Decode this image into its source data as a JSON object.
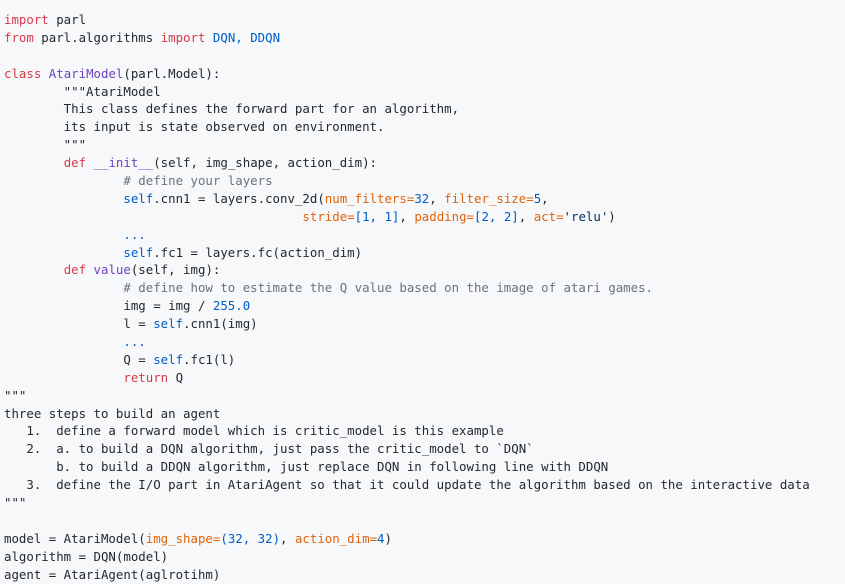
{
  "code": {
    "lines": [
      [
        {
          "t": "import",
          "c": "kw"
        },
        {
          "t": " parl",
          "c": "txt"
        }
      ],
      [
        {
          "t": "from",
          "c": "kw"
        },
        {
          "t": " parl.algorithms ",
          "c": "txt"
        },
        {
          "t": "import",
          "c": "kw"
        },
        {
          "t": " DQN, DDQN",
          "c": "num"
        }
      ],
      [],
      [
        {
          "t": "class",
          "c": "kw"
        },
        {
          "t": " AtariModel",
          "c": "cls"
        },
        {
          "t": "(parl.Model):",
          "c": "txt"
        }
      ],
      [
        {
          "t": "        \"\"\"AtariModel",
          "c": "txt"
        }
      ],
      [
        {
          "t": "        This class defines the forward part for an algorithm,",
          "c": "txt"
        }
      ],
      [
        {
          "t": "        its input is state observed on environment.",
          "c": "txt"
        }
      ],
      [
        {
          "t": "        \"\"\"",
          "c": "txt"
        }
      ],
      [
        {
          "t": "        ",
          "c": "txt"
        },
        {
          "t": "def",
          "c": "kw"
        },
        {
          "t": " __init__",
          "c": "fn"
        },
        {
          "t": "(self, img_shape, action_dim):",
          "c": "txt"
        }
      ],
      [
        {
          "t": "                # define your layers",
          "c": "cm"
        }
      ],
      [
        {
          "t": "                self",
          "c": "num"
        },
        {
          "t": ".cnn1 = layers.conv_2d(",
          "c": "txt"
        },
        {
          "t": "num_filters=",
          "c": "arg"
        },
        {
          "t": "32",
          "c": "num"
        },
        {
          "t": ", ",
          "c": "txt"
        },
        {
          "t": "filter_size=",
          "c": "arg"
        },
        {
          "t": "5",
          "c": "num"
        },
        {
          "t": ",",
          "c": "txt"
        }
      ],
      [
        {
          "t": "                                        ",
          "c": "txt"
        },
        {
          "t": "stride=",
          "c": "arg"
        },
        {
          "t": "[1, 1]",
          "c": "num"
        },
        {
          "t": ", ",
          "c": "txt"
        },
        {
          "t": "padding=",
          "c": "arg"
        },
        {
          "t": "[2, 2]",
          "c": "num"
        },
        {
          "t": ", ",
          "c": "txt"
        },
        {
          "t": "act=",
          "c": "arg"
        },
        {
          "t": "'relu'",
          "c": "str"
        },
        {
          "t": ")",
          "c": "txt"
        }
      ],
      [
        {
          "t": "                ...",
          "c": "num"
        }
      ],
      [
        {
          "t": "                self",
          "c": "num"
        },
        {
          "t": ".fc1 = layers.fc(action_dim)",
          "c": "txt"
        }
      ],
      [
        {
          "t": "        ",
          "c": "txt"
        },
        {
          "t": "def",
          "c": "kw"
        },
        {
          "t": " value",
          "c": "fn"
        },
        {
          "t": "(self, img):",
          "c": "txt"
        }
      ],
      [
        {
          "t": "                # define how to estimate the Q value based on the image of atari games.",
          "c": "cm"
        }
      ],
      [
        {
          "t": "                img = img / ",
          "c": "txt"
        },
        {
          "t": "255.0",
          "c": "num"
        }
      ],
      [
        {
          "t": "                l = ",
          "c": "txt"
        },
        {
          "t": "self",
          "c": "num"
        },
        {
          "t": ".cnn1(img)",
          "c": "txt"
        }
      ],
      [
        {
          "t": "                ...",
          "c": "num"
        }
      ],
      [
        {
          "t": "                Q = ",
          "c": "txt"
        },
        {
          "t": "self",
          "c": "num"
        },
        {
          "t": ".fc1(l)",
          "c": "txt"
        }
      ],
      [
        {
          "t": "                return",
          "c": "kw"
        },
        {
          "t": " Q",
          "c": "txt"
        }
      ],
      [
        {
          "t": "\"\"\"",
          "c": "txt"
        }
      ],
      [
        {
          "t": "three steps to build an agent",
          "c": "txt"
        }
      ],
      [
        {
          "t": "   1.  define a forward model which is critic_model is this example",
          "c": "txt"
        }
      ],
      [
        {
          "t": "   2.  a. to build a DQN algorithm, just pass the critic_model to `DQN`",
          "c": "txt"
        }
      ],
      [
        {
          "t": "       b. to build a DDQN algorithm, just replace DQN in following line with DDQN",
          "c": "txt"
        }
      ],
      [
        {
          "t": "   3.  define the I/O part in AtariAgent so that it could update the algorithm based on the interactive data",
          "c": "txt"
        }
      ],
      [
        {
          "t": "\"\"\"",
          "c": "txt"
        }
      ],
      [],
      [
        {
          "t": "model = AtariModel(",
          "c": "txt"
        },
        {
          "t": "img_shape=",
          "c": "arg"
        },
        {
          "t": "(32, 32)",
          "c": "num"
        },
        {
          "t": ", ",
          "c": "txt"
        },
        {
          "t": "action_dim=",
          "c": "arg"
        },
        {
          "t": "4",
          "c": "num"
        },
        {
          "t": ")",
          "c": "txt"
        }
      ],
      [
        {
          "t": "algorithm = DQN(model)",
          "c": "txt"
        }
      ],
      [
        {
          "t": "agent = AtariAgent(aglrotihm)",
          "c": "txt"
        }
      ]
    ]
  }
}
